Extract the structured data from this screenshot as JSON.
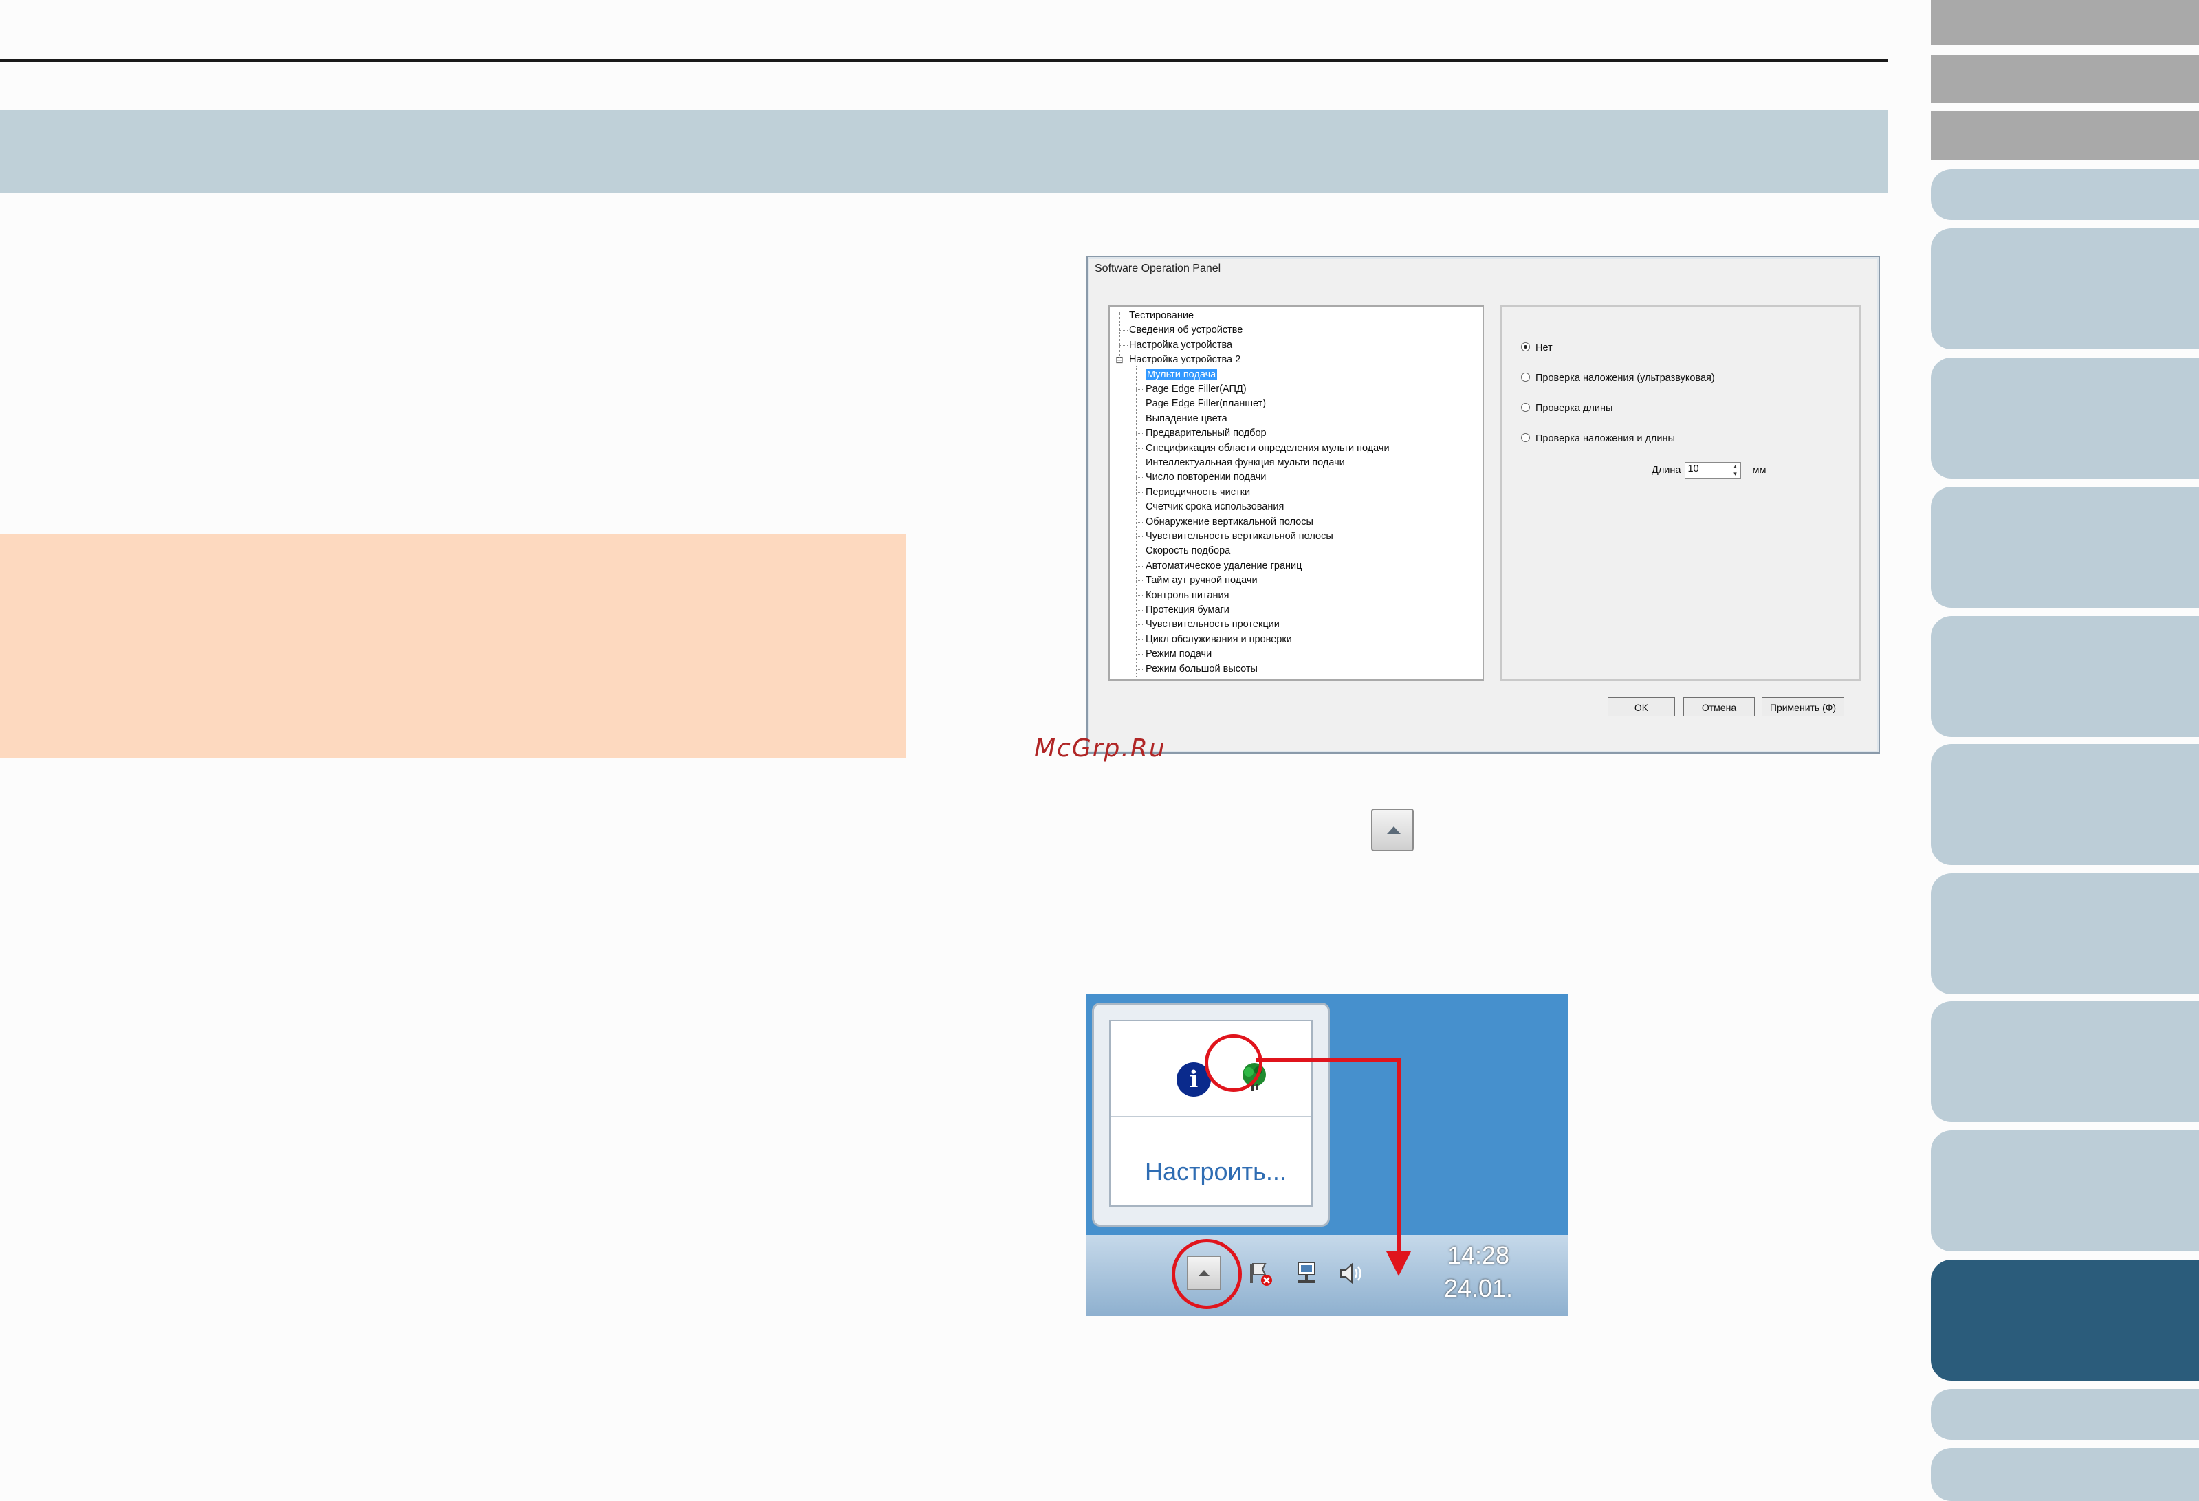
{
  "dialog": {
    "title": "Software Operation Panel",
    "tree": [
      {
        "label": "Тестирование",
        "level": 0
      },
      {
        "label": "Сведения об устройстве",
        "level": 0
      },
      {
        "label": "Настройка устройства",
        "level": 0
      },
      {
        "label": "Настройка устройства 2",
        "level": 0,
        "expander": "⊟"
      },
      {
        "label": "Мульти подача",
        "level": 1,
        "selected": true
      },
      {
        "label": "Page Edge Filler(АПД)",
        "level": 1
      },
      {
        "label": "Page Edge Filler(планшет)",
        "level": 1
      },
      {
        "label": "Выпадение цвета",
        "level": 1
      },
      {
        "label": "Предварительный подбор",
        "level": 1
      },
      {
        "label": "Спецификация области определения мульти подачи",
        "level": 1
      },
      {
        "label": "Интеллектуальная функция мульти подачи",
        "level": 1
      },
      {
        "label": "Число повторении подачи",
        "level": 1
      },
      {
        "label": "Периодичность чистки",
        "level": 1
      },
      {
        "label": "Счетчик срока использования",
        "level": 1
      },
      {
        "label": "Обнаружение вертикальной полосы",
        "level": 1
      },
      {
        "label": "Чувствительность вертикальной полосы",
        "level": 1
      },
      {
        "label": "Скорость подбора",
        "level": 1
      },
      {
        "label": "Автоматическое удаление границ",
        "level": 1
      },
      {
        "label": "Тайм аут ручной подачи",
        "level": 1
      },
      {
        "label": "Контроль питания",
        "level": 1
      },
      {
        "label": "Протекция бумаги",
        "level": 1
      },
      {
        "label": "Чувствительность протекции",
        "level": 1
      },
      {
        "label": "Цикл обслуживания и проверки",
        "level": 1
      },
      {
        "label": "Режим подачи",
        "level": 1
      },
      {
        "label": "Режим большой высоты",
        "level": 1
      }
    ],
    "options": [
      {
        "label": "Нет",
        "checked": true
      },
      {
        "label": "Проверка наложения (ультразвуковая)",
        "checked": false
      },
      {
        "label": "Проверка длины",
        "checked": false
      },
      {
        "label": "Проверка наложения и длины",
        "checked": false
      }
    ],
    "length_label": "Длина",
    "length_value": "10",
    "length_unit": "мм",
    "buttons": {
      "ok": "OK",
      "cancel": "Отмена",
      "apply": "Применить (Ф)"
    }
  },
  "watermark": "McGrp.Ru",
  "tray": {
    "customize": "Настроить...",
    "time": "14:28",
    "date": "24.01."
  },
  "colors": {
    "accent_red": "#e0141c",
    "side_tab": "#bccdd7",
    "side_tab_active": "#2b5c7b",
    "note_box": "#fdd9bf",
    "title_band": "#bfd0d8"
  }
}
